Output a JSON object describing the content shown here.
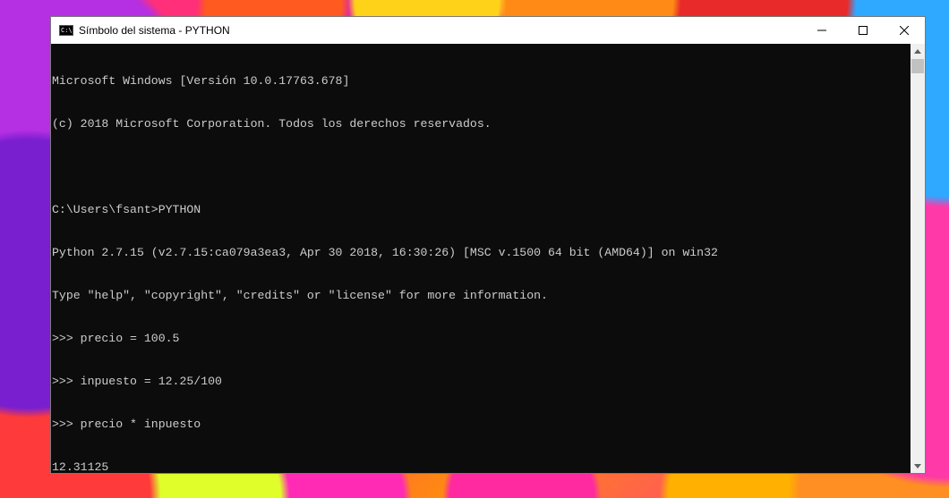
{
  "window": {
    "title": "Símbolo del sistema - PYTHON",
    "app_icon_text": "C:\\",
    "caption_buttons": [
      "minimize-icon",
      "maximize-icon",
      "close-icon"
    ]
  },
  "console": {
    "lines": [
      "Microsoft Windows [Versión 10.0.17763.678]",
      "(c) 2018 Microsoft Corporation. Todos los derechos reservados.",
      "",
      "C:\\Users\\fsant>PYTHON",
      "Python 2.7.15 (v2.7.15:ca079a3ea3, Apr 30 2018, 16:30:26) [MSC v.1500 64 bit (AMD64)] on win32",
      "Type \"help\", \"copyright\", \"credits\" or \"license\" for more information.",
      ">>> precio = 100.5",
      ">>> inpuesto = 12.25/100",
      ">>> precio * inpuesto",
      "12.31125",
      ">>>"
    ]
  },
  "scrollbar": {
    "up_icon": "scroll-up-arrow-icon",
    "down_icon": "scroll-down-arrow-icon"
  },
  "colors": {
    "console_bg": "#0c0c0c",
    "console_text": "#cccccc",
    "titlebar_bg": "#ffffff"
  }
}
